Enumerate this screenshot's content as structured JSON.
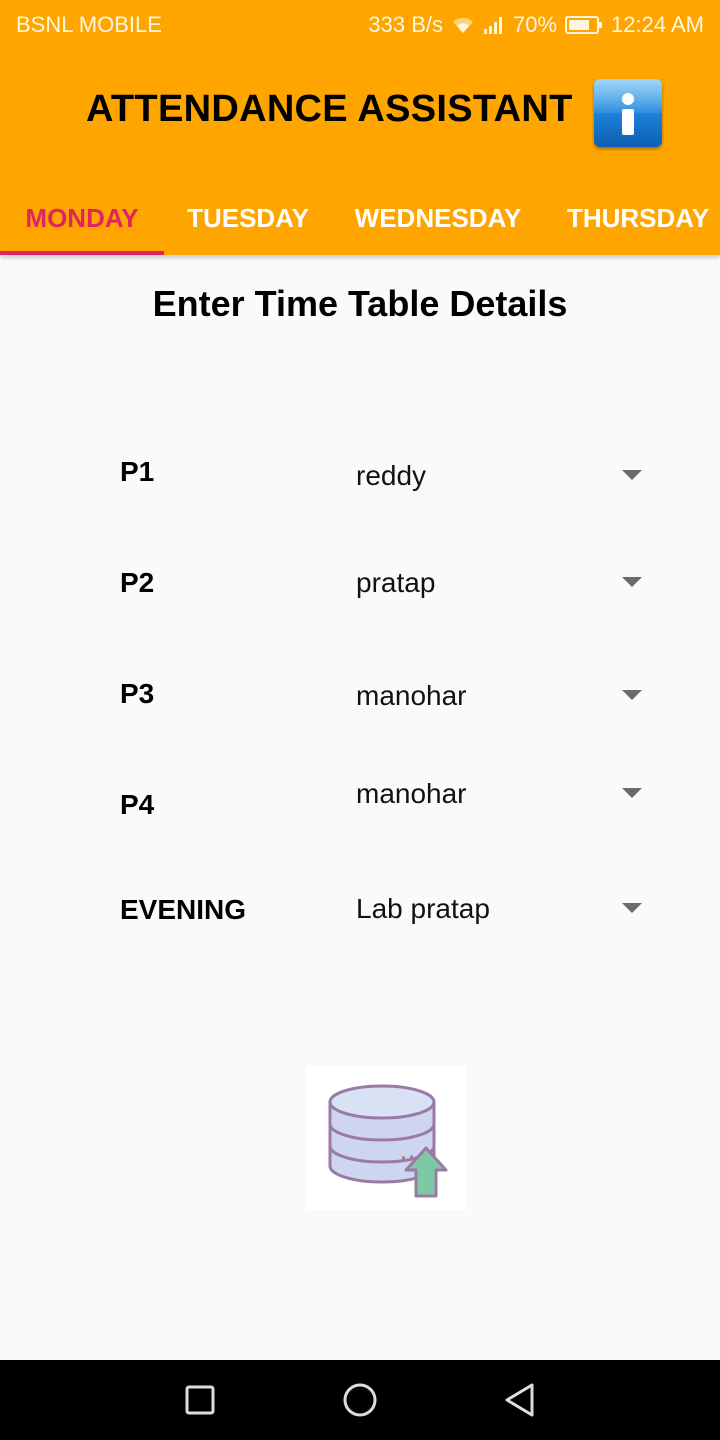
{
  "status_bar": {
    "carrier": "BSNL MOBILE",
    "speed": "333 B/s",
    "battery": "70%",
    "time": "12:24 AM"
  },
  "app": {
    "title": "ATTENDANCE ASSISTANT",
    "info_icon": "info-icon",
    "accent_color": "#ffa500",
    "active_tab_color": "#e0245e"
  },
  "tabs": [
    {
      "label": "MONDAY",
      "active": true
    },
    {
      "label": "TUESDAY",
      "active": false
    },
    {
      "label": "WEDNESDAY",
      "active": false
    },
    {
      "label": "THURSDAY",
      "active": false
    }
  ],
  "form": {
    "heading": "Enter Time Table Details",
    "rows": [
      {
        "label": "P1",
        "value": "reddy"
      },
      {
        "label": "P2",
        "value": "pratap"
      },
      {
        "label": "P3",
        "value": "manohar"
      },
      {
        "label": "P4",
        "value": "manohar"
      },
      {
        "label": "EVENING",
        "value": "Lab pratap"
      }
    ],
    "upload_icon": "database-upload-icon"
  },
  "nav_bar": {
    "icons": [
      "square-recents-icon",
      "circle-home-icon",
      "triangle-back-icon"
    ]
  }
}
